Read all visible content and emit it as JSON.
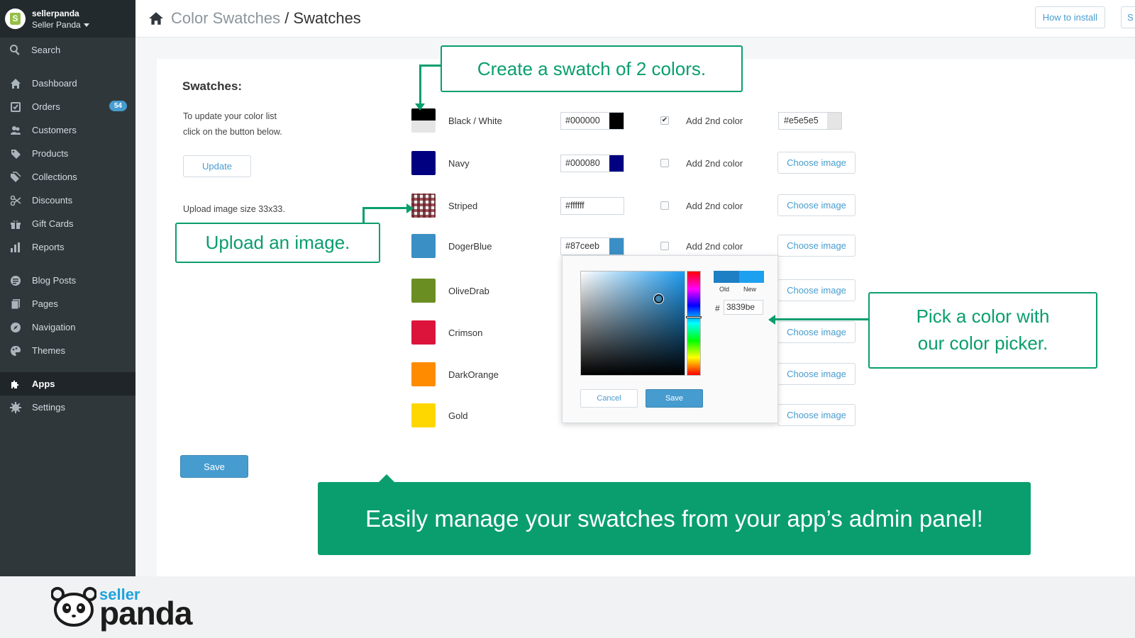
{
  "sidebar": {
    "store_name": "sellerpanda",
    "store_sub": "Seller Panda",
    "search_label": "Search",
    "items": [
      {
        "label": "Dashboard",
        "icon": "home-icon"
      },
      {
        "label": "Orders",
        "icon": "orders-icon",
        "badge": "54"
      },
      {
        "label": "Customers",
        "icon": "customers-icon"
      },
      {
        "label": "Products",
        "icon": "tag-icon"
      },
      {
        "label": "Collections",
        "icon": "tags-icon"
      },
      {
        "label": "Discounts",
        "icon": "scissors-icon"
      },
      {
        "label": "Gift Cards",
        "icon": "gift-icon"
      },
      {
        "label": "Reports",
        "icon": "bar-chart-icon"
      },
      {
        "label": "Blog Posts",
        "icon": "blog-icon"
      },
      {
        "label": "Pages",
        "icon": "pages-icon"
      },
      {
        "label": "Navigation",
        "icon": "compass-icon"
      },
      {
        "label": "Themes",
        "icon": "palette-icon"
      },
      {
        "label": "Apps",
        "icon": "puzzle-icon",
        "active": true
      },
      {
        "label": "Settings",
        "icon": "gear-icon"
      }
    ]
  },
  "topbar": {
    "crumb_parent": "Color Swatches",
    "crumb_separator": " / ",
    "crumb_current": "Swatches",
    "how_to_install": "How to install",
    "edge_button": "S"
  },
  "panel": {
    "heading": "Swatches:",
    "desc_line1": "To update your color list",
    "desc_line2": "click on the button below.",
    "update_button": "Update",
    "upload_note": "Upload image size 33x33.",
    "save_button": "Save"
  },
  "swatches": [
    {
      "name": "Black / White",
      "hex": "#000000",
      "color": "#000000",
      "second_color": "#e5e5e5",
      "checked": true,
      "hex2": "#e5e5e5"
    },
    {
      "name": "Navy",
      "hex": "#000080",
      "color": "#000080",
      "checked": false,
      "choose_label": "Choose image"
    },
    {
      "name": "Striped",
      "hex": "#ffffff",
      "color": "#ffffff",
      "checked": false,
      "choose_label": "Choose image",
      "image": "plaid-pattern"
    },
    {
      "name": "DogerBlue",
      "hex": "#87ceeb",
      "color": "#3a8fc4",
      "checked": false,
      "choose_label": "Choose image"
    },
    {
      "name": "OliveDrab",
      "color": "#6b8e23",
      "choose_label": "Choose image"
    },
    {
      "name": "Crimson",
      "color": "#dc143c",
      "choose_label": "Choose image"
    },
    {
      "name": "DarkOrange",
      "color": "#ff8c00",
      "choose_label": "Choose image"
    },
    {
      "name": "Gold",
      "color": "#ffd700",
      "choose_label": "Choose image"
    }
  ],
  "add_second_label": "Add 2nd color",
  "color_picker": {
    "old_label": "Old",
    "new_label": "New",
    "hash": "#",
    "hex_value": "3839be",
    "old_color": "#1e7fc4",
    "new_color": "#1ea0f0",
    "cancel_label": "Cancel",
    "save_label": "Save"
  },
  "callouts": {
    "two_colors": "Create a swatch of 2 colors.",
    "upload": "Upload an image.",
    "picker_line1": "Pick a color with",
    "picker_line2": "our color picker.",
    "banner": "Easily manage your swatches from your app’s admin panel!"
  },
  "branding": {
    "logo_small": "seller",
    "logo_large": "panda",
    "accent": "#0a9e6e",
    "link_blue": "#479ccf"
  }
}
